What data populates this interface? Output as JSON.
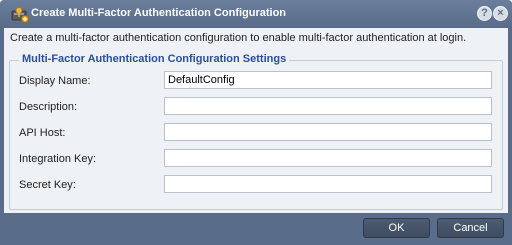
{
  "dialog": {
    "title": "Create Multi-Factor Authentication Configuration",
    "help_label": "?",
    "close_label": "×",
    "description": "Create a multi-factor authentication configuration to enable multi-factor authentication at login."
  },
  "settings": {
    "legend": "Multi-Factor Authentication Configuration Settings",
    "fields": [
      {
        "label": "Display Name:",
        "value": "DefaultConfig"
      },
      {
        "label": "Description:",
        "value": ""
      },
      {
        "label": "API Host:",
        "value": ""
      },
      {
        "label": "Integration Key:",
        "value": ""
      },
      {
        "label": "Secret Key:",
        "value": ""
      }
    ]
  },
  "buttons": {
    "ok": "OK",
    "cancel": "Cancel"
  },
  "colors": {
    "titlebar": "#596d8b",
    "panel": "#eef1f5",
    "legend_text": "#2c4ea0",
    "button": "#46556b"
  },
  "icons": {
    "title": "key-config-icon"
  }
}
